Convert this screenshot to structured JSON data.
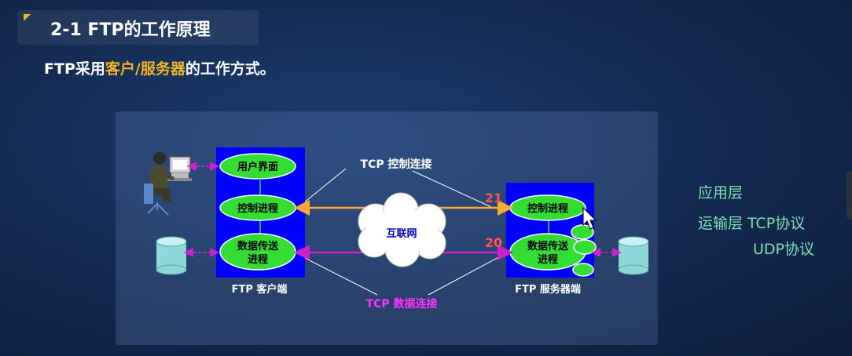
{
  "header": {
    "title": "2-1 FTP的工作原理"
  },
  "subtitle": {
    "prefix": "FTP采用",
    "highlight": "客户/服务器",
    "suffix": "的工作方式。"
  },
  "diagram": {
    "client": {
      "caption": "FTP 客户端",
      "ui_label": "用户界面",
      "control_label": "控制进程",
      "data_label_line1": "数据传送",
      "data_label_line2": "进程"
    },
    "server": {
      "caption": "FTP 服务器端",
      "control_label": "控制进程",
      "data_label_line1": "数据传送",
      "data_label_line2": "进程"
    },
    "internet_label": "互联网",
    "control_conn_label": "TCP 控制连接",
    "data_conn_label": "TCP 数据连接",
    "control_port": "21",
    "data_port": "20",
    "colors": {
      "box_blue": "#0000ff",
      "ellipse_green": "#33dd33",
      "control_line": "#ffaa33",
      "data_line": "#cc22cc",
      "port_red": "#ff5555",
      "data_conn_label": "#ff33ff"
    }
  },
  "side_notes": {
    "app_layer": "应用层",
    "transport_layer": "运输层 TCP协议",
    "udp": "UDP协议"
  }
}
